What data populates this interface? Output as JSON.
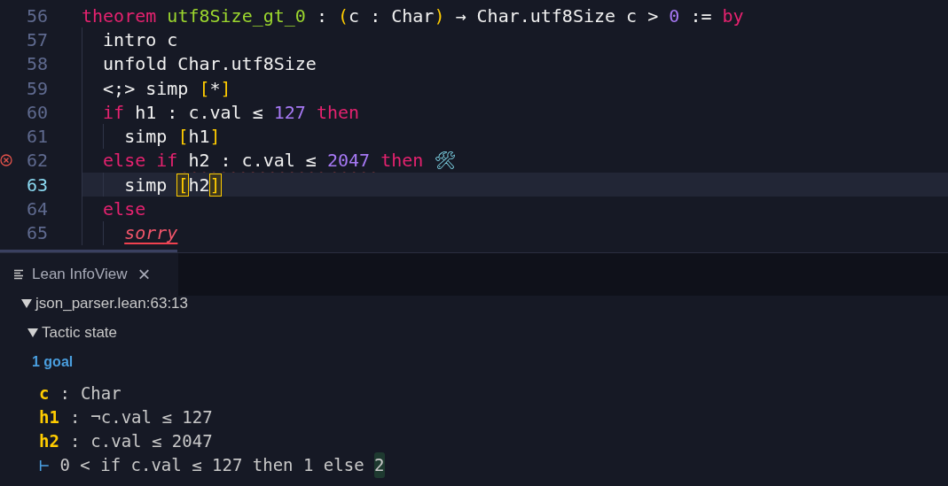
{
  "editor": {
    "lines": [
      {
        "number": "56",
        "selected": false,
        "error": false,
        "tokens": [
          {
            "kind": "keyword",
            "text": "theorem"
          },
          {
            "kind": "name",
            "text": " utf8Size_gt_0"
          },
          {
            "kind": "plain",
            "text": " : "
          },
          {
            "kind": "paren",
            "text": "("
          },
          {
            "kind": "plain",
            "text": "c : Char"
          },
          {
            "kind": "paren",
            "text": ")"
          },
          {
            "kind": "plain",
            "text": " → Char.utf8Size c > "
          },
          {
            "kind": "number",
            "text": "0"
          },
          {
            "kind": "plain",
            "text": " := "
          },
          {
            "kind": "keyword",
            "text": "by"
          }
        ]
      },
      {
        "number": "57",
        "selected": false,
        "error": false,
        "tokens": [
          {
            "kind": "plain",
            "text": "  intro c"
          }
        ]
      },
      {
        "number": "58",
        "selected": false,
        "error": false,
        "tokens": [
          {
            "kind": "plain",
            "text": "  unfold Char.utf8Size"
          }
        ]
      },
      {
        "number": "59",
        "selected": false,
        "error": false,
        "tokens": [
          {
            "kind": "plain",
            "text": "  <;> simp "
          },
          {
            "kind": "paren",
            "text": "["
          },
          {
            "kind": "plain",
            "text": "*"
          },
          {
            "kind": "paren",
            "text": "]"
          }
        ]
      },
      {
        "number": "60",
        "selected": false,
        "error": false,
        "tokens": [
          {
            "kind": "keyword",
            "text": "  if"
          },
          {
            "kind": "plain",
            "text": " h1 : c.val ≤ "
          },
          {
            "kind": "number",
            "text": "127"
          },
          {
            "kind": "keyword",
            "text": " then"
          }
        ]
      },
      {
        "number": "61",
        "selected": false,
        "error": false,
        "tokens": [
          {
            "kind": "plain",
            "text": "    simp "
          },
          {
            "kind": "paren",
            "text": "["
          },
          {
            "kind": "plain",
            "text": "h1"
          },
          {
            "kind": "paren",
            "text": "]"
          }
        ]
      },
      {
        "number": "62",
        "selected": false,
        "error": true,
        "tokens": [
          {
            "kind": "keyword",
            "text": "  else if"
          },
          {
            "kind": "plain",
            "text": " h2 : c.val ≤ ",
            "error": true
          },
          {
            "kind": "number",
            "text": "2047 ",
            "error": true
          },
          {
            "kind": "keyword",
            "text": "then"
          },
          {
            "kind": "tool",
            "text": " 🛠"
          }
        ]
      },
      {
        "number": "63",
        "selected": true,
        "error": false,
        "tokens": [
          {
            "kind": "plain",
            "text": "    simp "
          },
          {
            "kind": "paren",
            "text": "[",
            "matched": true
          },
          {
            "kind": "plain",
            "text": "h2"
          },
          {
            "kind": "paren",
            "text": "]",
            "matched": true
          }
        ]
      },
      {
        "number": "64",
        "selected": false,
        "error": false,
        "tokens": [
          {
            "kind": "keyword",
            "text": "  else"
          }
        ]
      },
      {
        "number": "65",
        "selected": false,
        "error": false,
        "tokens": [
          {
            "kind": "sorry",
            "text": "    sorry",
            "error": true
          }
        ]
      }
    ]
  },
  "infoview": {
    "tab": {
      "title": "Lean InfoView",
      "close": "×"
    },
    "location": {
      "label": "json_parser.lean:63:13",
      "expanded": true
    },
    "tactic_state": {
      "label": "Tactic state",
      "expanded": true
    },
    "goal_count": "1 goal",
    "hypotheses": [
      {
        "name": "c",
        "colon": ":",
        "type": "Char"
      },
      {
        "name": "h1",
        "colon": ":",
        "type": "¬c.val ≤ 127"
      },
      {
        "name": "h2",
        "colon": ":",
        "type": "c.val ≤ 2047"
      }
    ],
    "target": {
      "symbol": "⊢",
      "parts": [
        {
          "text": "0 < if c.val ≤ 127 then 1 else ",
          "highlighted": false
        },
        {
          "text": "2",
          "highlighted": true
        }
      ]
    }
  }
}
